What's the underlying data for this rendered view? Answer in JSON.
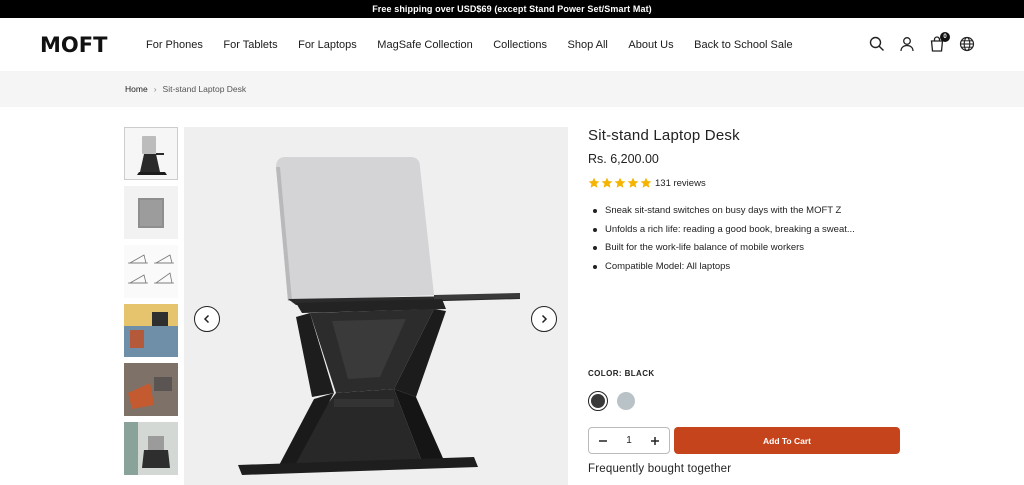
{
  "announcement": "Free shipping over USD$69 (except Stand Power Set/Smart Mat)",
  "header": {
    "logo": "MOFT",
    "nav": [
      "For Phones",
      "For Tablets",
      "For Laptops",
      "MagSafe Collection",
      "Collections",
      "Shop All",
      "About Us",
      "Back to School Sale"
    ],
    "icons": [
      "search-icon",
      "account-icon",
      "cart-icon",
      "globe-icon"
    ],
    "cart_count": "0"
  },
  "breadcrumb": {
    "home": "Home",
    "separator": "›",
    "current": "Sit-stand Laptop Desk"
  },
  "product": {
    "title": "Sit-stand Laptop Desk",
    "price": "Rs. 6,200.00",
    "rating": 5,
    "reviews": "131 reviews",
    "bullets": [
      "Sneak sit-stand switches on busy days with the MOFT Z",
      "Unfolds a rich life: reading a good book, breaking a sweat...",
      "Built for the work-life balance of mobile workers",
      "Compatible Model: All laptops"
    ],
    "color_label": "COLOR: BLACK",
    "colors": [
      "#3a3a3a",
      "#b9c3c7"
    ],
    "quantity": "1",
    "add_to_cart": "Add To Cart",
    "frequently_bought": "Frequently bought together"
  },
  "colors": {
    "accent": "#c6441c",
    "star": "#f5b400",
    "announce_bg": "#000000"
  }
}
